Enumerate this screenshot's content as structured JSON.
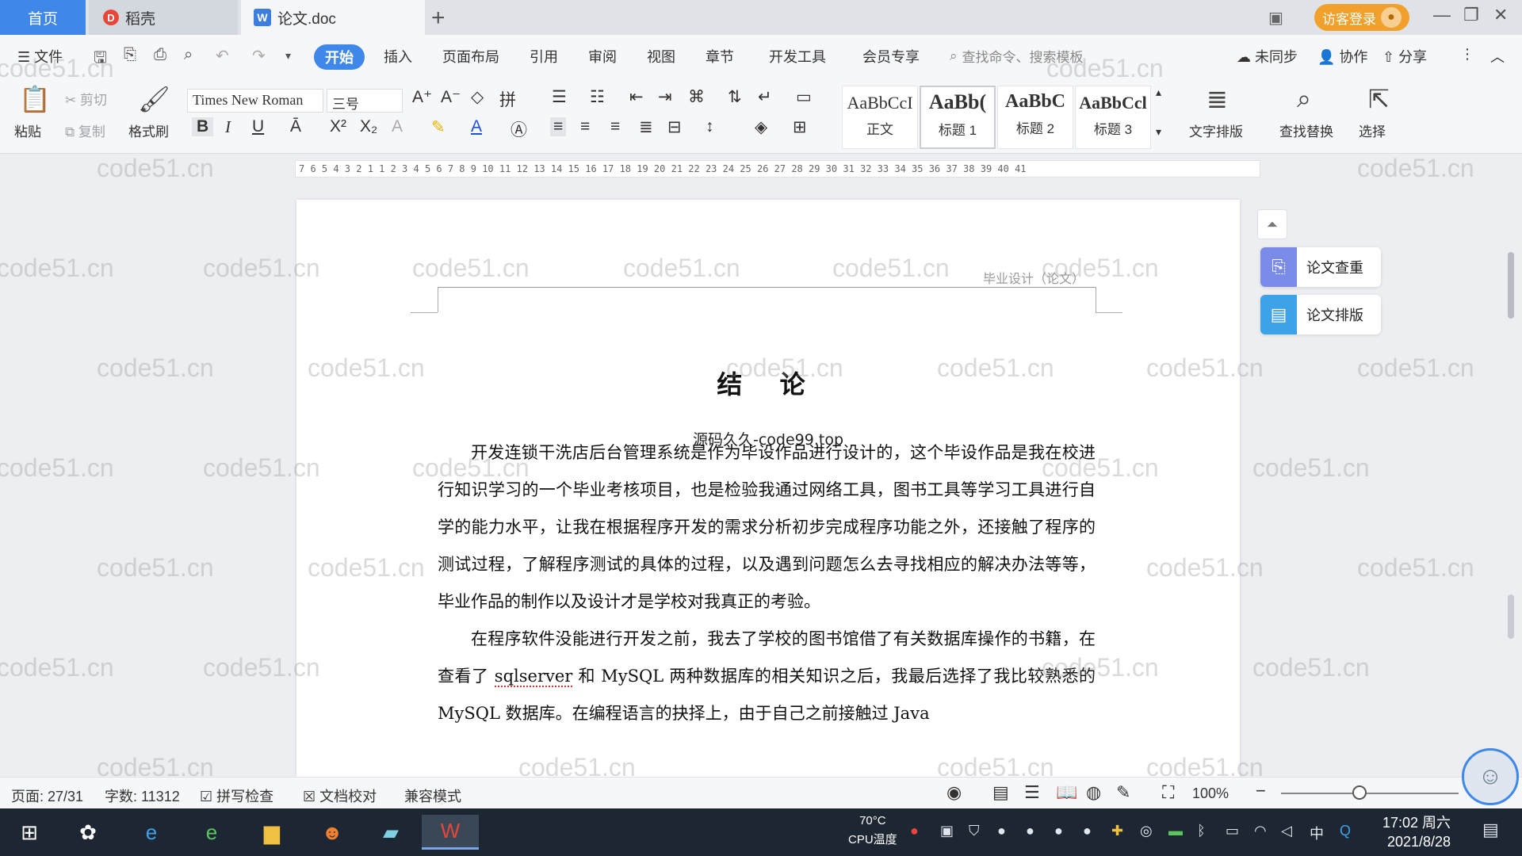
{
  "titlebar": {
    "tabs": [
      {
        "label": "首页"
      },
      {
        "label": "稻壳"
      },
      {
        "label": "论文.doc"
      }
    ],
    "new_tab": "+",
    "login_label": "访客登录"
  },
  "menubar": {
    "file": "文件",
    "tabs": [
      "开始",
      "插入",
      "页面布局",
      "引用",
      "审阅",
      "视图",
      "章节",
      "开发工具",
      "会员专享"
    ],
    "search_placeholder": "查找命令、搜索模板",
    "sync": "未同步",
    "collab": "协作",
    "share": "分享"
  },
  "ribbon": {
    "paste": "粘贴",
    "cut": "剪切",
    "copy": "复制",
    "format_painter": "格式刷",
    "font_name": "Times New Roman",
    "font_size": "三号",
    "styles": [
      {
        "preview": "AaBbCcI",
        "name": "正文"
      },
      {
        "preview": "AaBb(",
        "name": "标题 1"
      },
      {
        "preview": "AaBbC",
        "name": "标题 2"
      },
      {
        "preview": "AaBbCcl",
        "name": "标题 3"
      }
    ],
    "text_layout": "文字排版",
    "find_replace": "查找替换",
    "select": "选择"
  },
  "ruler": {
    "numbers": "7 6 5 4 3 2 1    1 2 3 4 5 6 7 8 9 10 11 12 13 14 15 16 17 18 19 20 21 22 23 24 25 26 27 28 29 30 31 32 33 34 35 36 37 38 39 40 41"
  },
  "document": {
    "header": "毕业设计（论文）",
    "title": "结 论",
    "overlay_note": "源码久久-code99.top",
    "p1": "开发连锁干洗店后台管理系统是作为毕设作品进行设计的，这个毕设作品是我在校进行知识学习的一个毕业考核项目，也是检验我通过网络工具，图书工具等学习工具进行自学的能力水平，让我在根据程序开发的需求分析初步完成程序功能之外，还接触了程序的测试过程，了解程序测试的具体的过程，以及遇到问题怎么去寻找相应的解决办法等等，毕业作品的制作以及设计才是学校对我真正的考验。",
    "p2_a": "在程序软件没能进行开发之前，我去了学校的图书馆借了有关数据库操作的书籍，在查看了 ",
    "p2_spell": "sqlserver",
    "p2_b": " 和 MySQL 两种数据库的相关知识之后，我最后选择了我比较熟悉的 MySQL 数据库。在编程语言的抉择上，由于自己之前接触过 Java"
  },
  "side_panel": {
    "check": "论文查重",
    "layout": "论文排版"
  },
  "statusbar": {
    "page": "页面: 27/31",
    "words": "字数: 11312",
    "spell_check": "拼写检查",
    "proofread": "文档校对",
    "compat": "兼容模式",
    "zoom": "100%"
  },
  "taskbar": {
    "cpu_temp": "70°C",
    "cpu_label": "CPU温度",
    "ime": "中",
    "time": "17:02 周六",
    "date": "2021/8/28"
  },
  "watermark": "code51.cn"
}
